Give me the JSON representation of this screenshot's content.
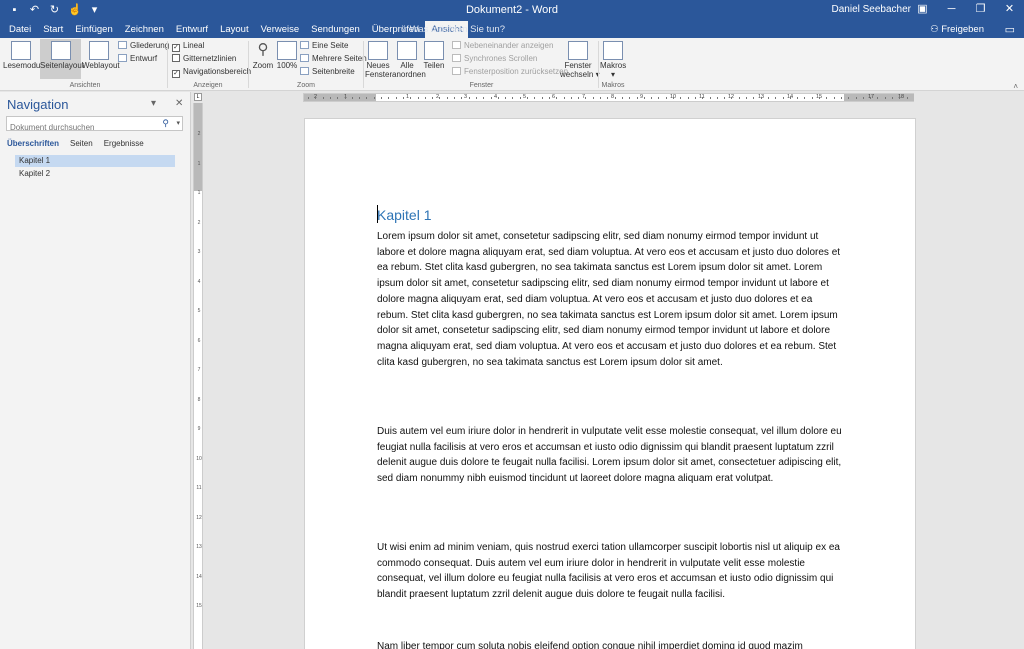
{
  "title_bar": {
    "document_title": "Dokument2 - Word",
    "user_name": "Daniel Seebacher",
    "qat": {
      "save_icon": "save-icon",
      "undo_icon": "undo-icon",
      "redo_icon": "redo-icon",
      "touch_icon": "touch-mode-icon"
    }
  },
  "tabs": [
    "Datei",
    "Start",
    "Einfügen",
    "Zeichnen",
    "Entwurf",
    "Layout",
    "Verweise",
    "Sendungen",
    "Überprüfen",
    "Ansicht"
  ],
  "active_tab": "Ansicht",
  "tell_me": "Was möchten Sie tun?",
  "share_label": "Freigeben",
  "ribbon": {
    "ansichten": {
      "label": "Ansichten",
      "lesemodus": "Lesemodus",
      "seitenlayout": "Seitenlayout",
      "weblayout": "Weblayout",
      "gliederung": "Gliederung",
      "entwurf": "Entwurf"
    },
    "anzeigen": {
      "label": "Anzeigen",
      "lineal": "Lineal",
      "gitternetzlinien": "Gitternetzlinien",
      "navigationsbereich": "Navigationsbereich"
    },
    "zoom": {
      "label": "Zoom",
      "zoom": "Zoom",
      "hundred": "100%",
      "eine_seite": "Eine Seite",
      "mehrere_seiten": "Mehrere Seiten",
      "seitenbreite": "Seitenbreite"
    },
    "fenster": {
      "label": "Fenster",
      "neues_fenster_1": "Neues",
      "neues_fenster_2": "Fenster",
      "alle_anordnen_1": "Alle",
      "alle_anordnen_2": "anordnen",
      "teilen": "Teilen",
      "nebeneinander": "Nebeneinander anzeigen",
      "synchrones_scrollen": "Synchrones Scrollen",
      "fensterposition": "Fensterposition zurücksetzen",
      "fenster_wechseln_1": "Fenster",
      "fenster_wechseln_2": "wechseln"
    },
    "makros": {
      "label": "Makros",
      "makros": "Makros"
    }
  },
  "navigation": {
    "title": "Navigation",
    "search_placeholder": "Dokument durchsuchen",
    "tabs": [
      "Überschriften",
      "Seiten",
      "Ergebnisse"
    ],
    "items": [
      "Kapitel 1",
      "Kapitel 2"
    ],
    "selected_item": "Kapitel 1"
  },
  "ruler": {
    "h_numbers": [
      "2",
      "1",
      "1",
      "2",
      "3",
      "4",
      "5",
      "6",
      "7",
      "8",
      "9",
      "10",
      "11",
      "12",
      "13",
      "14",
      "15",
      "17",
      "18"
    ],
    "v_numbers": [
      "2",
      "1",
      "1",
      "2",
      "3",
      "4",
      "5",
      "6",
      "7",
      "8",
      "9",
      "10",
      "11",
      "12",
      "13",
      "14",
      "15"
    ]
  },
  "document": {
    "heading": "Kapitel 1",
    "paragraphs": [
      "Lorem ipsum dolor sit amet, consetetur sadipscing elitr, sed diam nonumy eirmod tempor invidunt ut labore et dolore magna aliquyam erat, sed diam voluptua. At vero eos et accusam et justo duo dolores et ea rebum. Stet clita kasd gubergren, no sea takimata sanctus est Lorem ipsum dolor sit amet. Lorem ipsum dolor sit amet, consetetur sadipscing elitr, sed diam nonumy eirmod tempor invidunt ut labore et dolore magna aliquyam erat, sed diam voluptua. At vero eos et accusam et justo duo dolores et ea rebum. Stet clita kasd gubergren, no sea takimata sanctus est Lorem ipsum dolor sit amet. Lorem ipsum dolor sit amet, consetetur sadipscing elitr, sed diam nonumy eirmod tempor invidunt ut labore et dolore magna aliquyam erat, sed diam voluptua. At vero eos et accusam et justo duo dolores et ea rebum. Stet clita kasd gubergren, no sea takimata sanctus est Lorem ipsum dolor sit amet.",
      "Duis autem vel eum iriure dolor in hendrerit in vulputate velit esse molestie consequat, vel illum dolore eu feugiat nulla facilisis at vero eros et accumsan et iusto odio dignissim qui blandit praesent luptatum zzril delenit augue duis dolore te feugait nulla facilisi. Lorem ipsum dolor sit amet, consectetuer adipiscing elit, sed diam nonummy nibh euismod tincidunt ut laoreet dolore magna aliquam erat volutpat.",
      "Ut wisi enim ad minim veniam, quis nostrud exerci tation ullamcorper suscipit lobortis nisl ut aliquip ex ea commodo consequat. Duis autem vel eum iriure dolor in hendrerit in vulputate velit esse molestie consequat, vel illum dolore eu feugiat nulla facilisis at vero eros et accumsan et iusto odio dignissim qui blandit praesent luptatum zzril delenit augue duis dolore te feugait nulla facilisi.",
      "Nam liber tempor cum soluta nobis eleifend option congue nihil imperdiet doming id quod mazim"
    ]
  },
  "colors": {
    "accent": "#2b579a",
    "heading": "#2e74b5",
    "selected_nav": "#c5d9f1"
  }
}
